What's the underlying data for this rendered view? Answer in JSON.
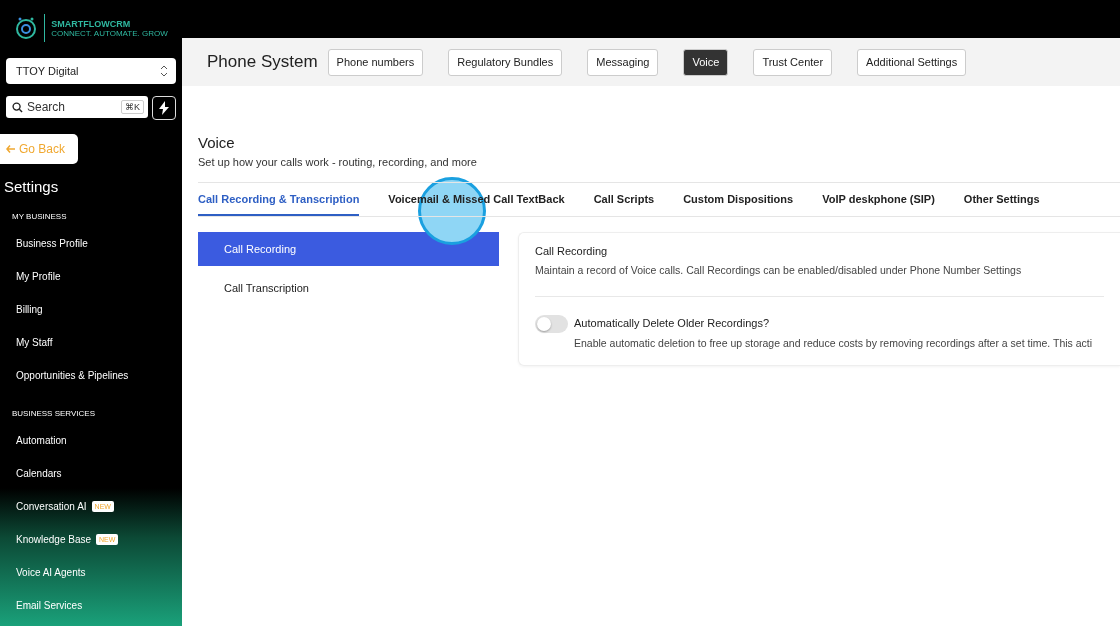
{
  "logo": {
    "name": "SMARTFLOWCRM",
    "tagline": "CONNECT. AUTOMATE. GROW"
  },
  "sidebar": {
    "account": "TTOY Digital",
    "search": {
      "placeholder": "Search",
      "shortcut": "⌘K"
    },
    "back": "Go Back",
    "title": "Settings",
    "sections": [
      {
        "heading": "MY BUSINESS",
        "items": [
          {
            "label": "Business Profile"
          },
          {
            "label": "My Profile"
          },
          {
            "label": "Billing"
          },
          {
            "label": "My Staff"
          },
          {
            "label": "Opportunities & Pipelines"
          }
        ]
      },
      {
        "heading": "BUSINESS SERVICES",
        "items": [
          {
            "label": "Automation"
          },
          {
            "label": "Calendars"
          },
          {
            "label": "Conversation AI",
            "badge": "NEW"
          },
          {
            "label": "Knowledge Base",
            "badge": "NEW"
          },
          {
            "label": "Voice AI Agents"
          },
          {
            "label": "Email Services"
          }
        ]
      }
    ]
  },
  "header": {
    "title": "Phone System",
    "tabs": [
      {
        "label": "Phone numbers",
        "selected": false
      },
      {
        "label": "Regulatory Bundles",
        "selected": false
      },
      {
        "label": "Messaging",
        "selected": false
      },
      {
        "label": "Voice",
        "selected": true
      },
      {
        "label": "Trust Center",
        "selected": false
      },
      {
        "label": "Additional Settings",
        "selected": false
      }
    ]
  },
  "page": {
    "title": "Voice",
    "subtitle": "Set up how your calls work - routing, recording, and more",
    "tabs": [
      {
        "label": "Call Recording & Transcription",
        "selected": true
      },
      {
        "label": "Voicemail & Missed Call TextBack",
        "selected": false
      },
      {
        "label": "Call Scripts",
        "selected": false
      },
      {
        "label": "Custom Dispositions",
        "selected": false
      },
      {
        "label": "VoIP deskphone (SIP)",
        "selected": false
      },
      {
        "label": "Other Settings",
        "selected": false
      }
    ],
    "menu": [
      {
        "label": "Call Recording",
        "selected": true
      },
      {
        "label": "Call Transcription",
        "selected": false
      }
    ],
    "panel": {
      "title": "Call Recording",
      "description": "Maintain a record of Voice calls. Call Recordings can be enabled/disabled under Phone Number Settings",
      "settings": [
        {
          "label": "Automatically Delete Older Recordings?",
          "description": "Enable automatic deletion to free up storage and reduce costs by removing recordings after a set time. This acti",
          "on": false
        }
      ]
    }
  }
}
